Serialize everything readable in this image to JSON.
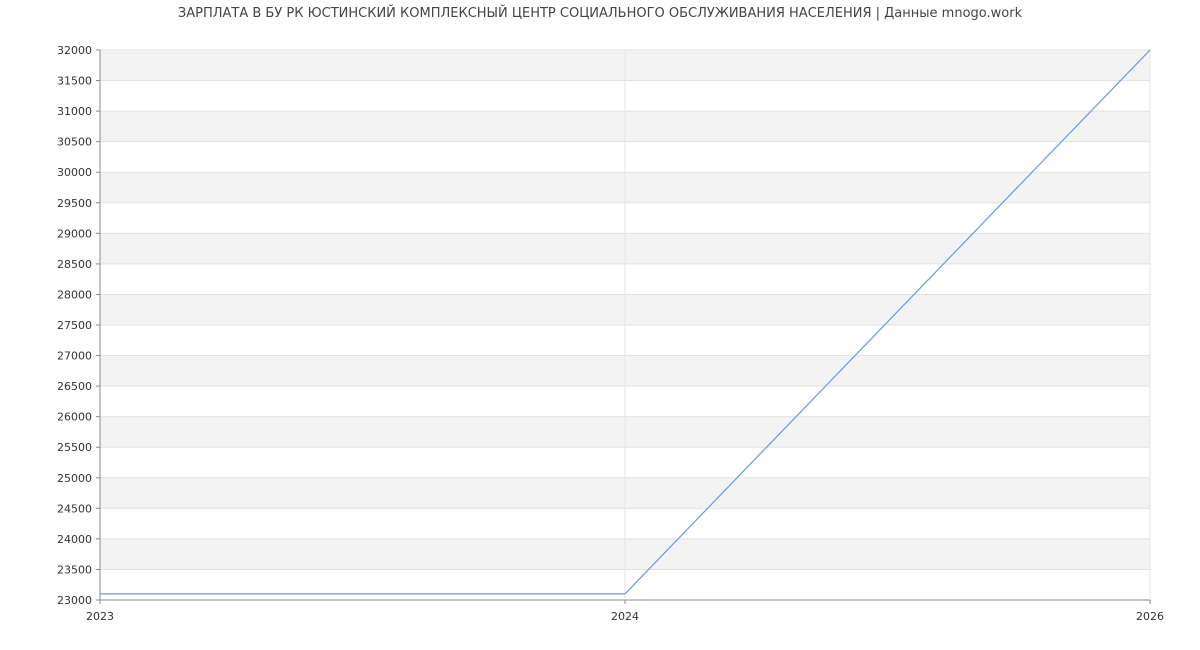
{
  "chart_data": {
    "type": "line",
    "title": "ЗАРПЛАТА В БУ РК ЮСТИНСКИЙ КОМПЛЕКСНЫЙ ЦЕНТР СОЦИАЛЬНОГО ОБСЛУЖИВАНИЯ НАСЕЛЕНИЯ | Данные mnogo.work",
    "xlabel": "",
    "ylabel": "",
    "x_ticks": [
      "2023",
      "2024",
      "2026"
    ],
    "y_ticks": [
      "23000",
      "23500",
      "24000",
      "24500",
      "25000",
      "25500",
      "26000",
      "26500",
      "27000",
      "27500",
      "28000",
      "28500",
      "29000",
      "29500",
      "30000",
      "30500",
      "31000",
      "31500",
      "32000"
    ],
    "ylim": [
      23000,
      32000
    ],
    "grid": true,
    "band_colors": [
      "#f3f3f3",
      "#ffffff"
    ],
    "series": [
      {
        "color": "#6a98e6",
        "x": [
          "2023",
          "2024",
          "2026"
        ],
        "values": [
          23100,
          23100,
          32000
        ]
      }
    ]
  }
}
